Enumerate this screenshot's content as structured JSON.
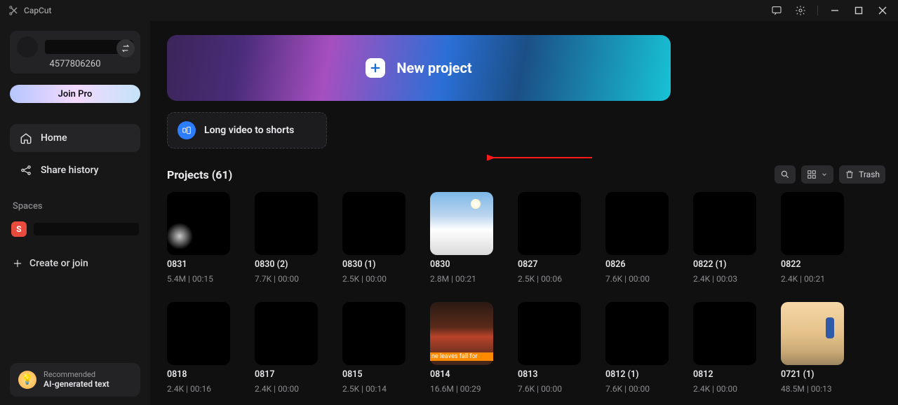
{
  "app_name": "CapCut",
  "titlebar": {
    "feedback_tooltip": "Feedback",
    "settings_tooltip": "Settings"
  },
  "account": {
    "id": "4577806260",
    "join_pro_label": "Join Pro"
  },
  "nav": {
    "home": "Home",
    "share_history": "Share history"
  },
  "spaces": {
    "label": "Spaces",
    "badge_letter": "S",
    "create_or_join": "Create or join"
  },
  "recommend": {
    "tag": "Recommended",
    "title": "AI-generated text"
  },
  "hero": {
    "new_project": "New project",
    "long_video_to_shorts": "Long video to shorts"
  },
  "projects": {
    "title": "Projects  (61)",
    "trash": "Trash",
    "items": [
      {
        "title": "0831",
        "meta": "5.4M | 00:15",
        "thumb": "smoke"
      },
      {
        "title": "0830 (2)",
        "meta": "7.7K | 00:00",
        "thumb": "black"
      },
      {
        "title": "0830 (1)",
        "meta": "2.5K | 00:00",
        "thumb": "black"
      },
      {
        "title": "0830",
        "meta": "2.8M | 00:21",
        "thumb": "sky"
      },
      {
        "title": "0827",
        "meta": "2.5K | 00:06",
        "thumb": "black"
      },
      {
        "title": "0826",
        "meta": "7.6K | 00:00",
        "thumb": "black"
      },
      {
        "title": "0822 (1)",
        "meta": "2.4K | 00:03",
        "thumb": "black"
      },
      {
        "title": "0822",
        "meta": "2.4K | 00:21",
        "thumb": "black"
      },
      {
        "title": "0818",
        "meta": "2.4K | 00:16",
        "thumb": "black"
      },
      {
        "title": "0817",
        "meta": "2.4K | 00:00",
        "thumb": "black"
      },
      {
        "title": "0815",
        "meta": "2.5K | 00:14",
        "thumb": "black"
      },
      {
        "title": "0814",
        "meta": "16.6M | 00:29",
        "thumb": "guitar",
        "caption": "ne leaves fall for"
      },
      {
        "title": "0813",
        "meta": "7.6K | 00:00",
        "thumb": "black"
      },
      {
        "title": "0812 (1)",
        "meta": "7.6K | 00:00",
        "thumb": "black"
      },
      {
        "title": "0812",
        "meta": "2.4K | 00:00",
        "thumb": "black"
      },
      {
        "title": "0721 (1)",
        "meta": "48.5M | 00:13",
        "thumb": "beach"
      }
    ]
  }
}
